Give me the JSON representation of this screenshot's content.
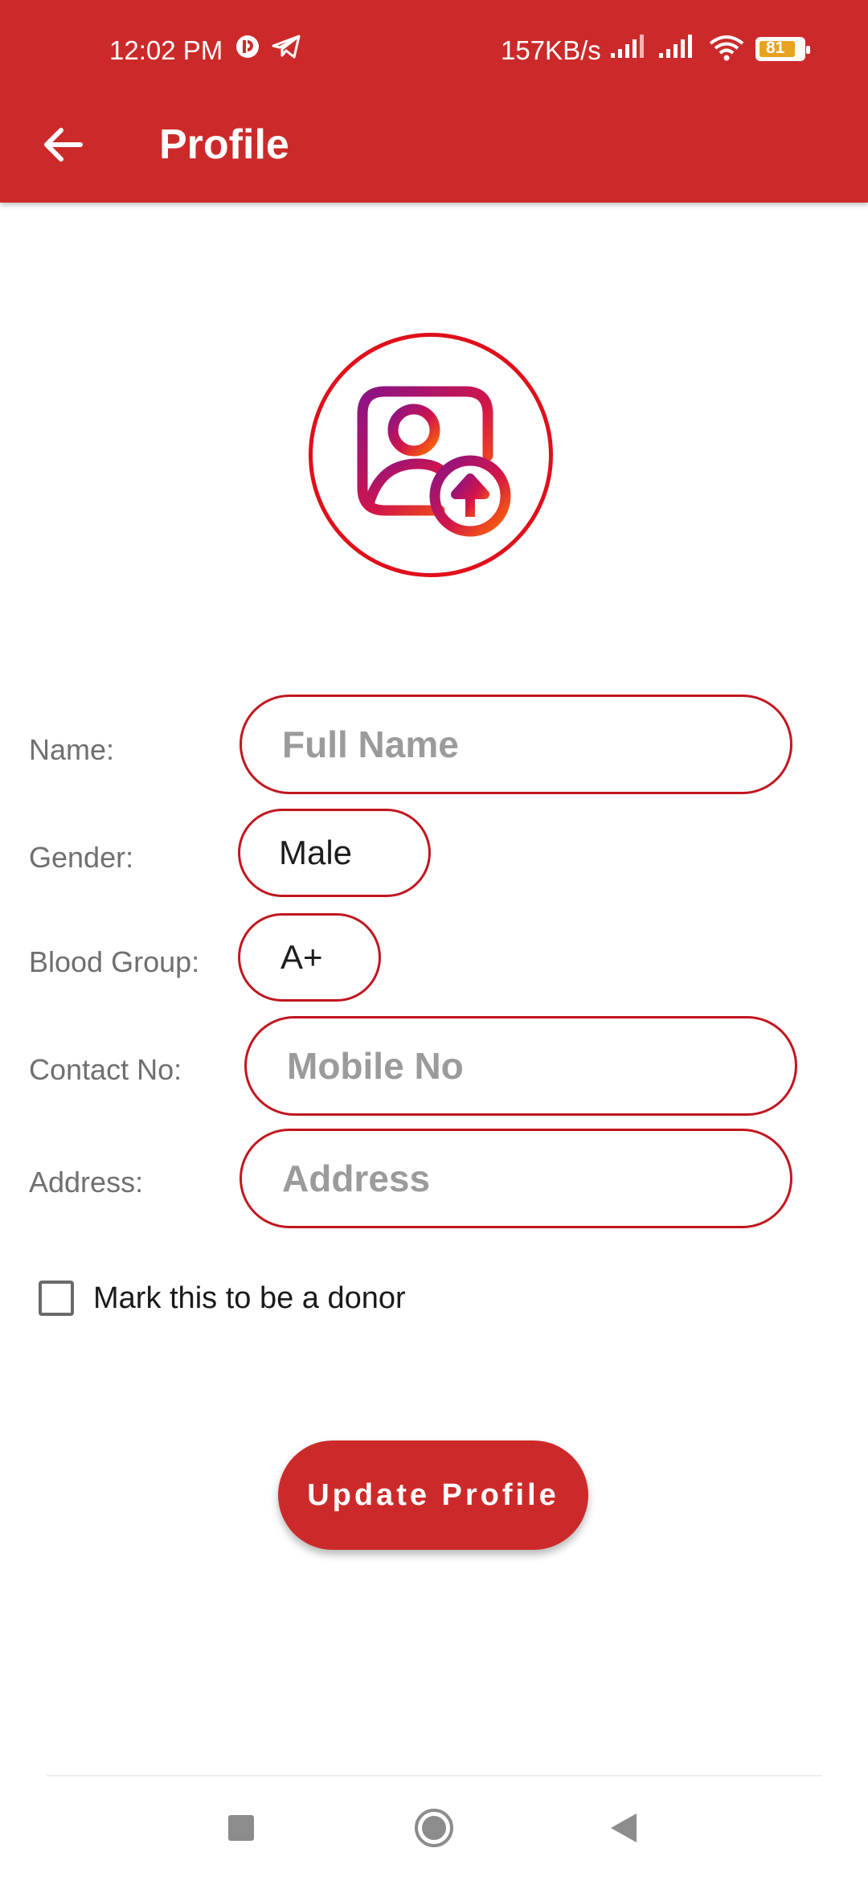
{
  "status_bar": {
    "time": "12:02 PM",
    "speed": "157KB/s",
    "battery": "81"
  },
  "header": {
    "title": "Profile"
  },
  "form": {
    "name_label": "Name:",
    "name_placeholder": "Full Name",
    "gender_label": "Gender:",
    "gender_value": "Male",
    "blood_label": "Blood Group:",
    "blood_value": "A+",
    "contact_label": "Contact No:",
    "contact_placeholder": "Mobile No",
    "address_label": "Address:",
    "address_placeholder": "Address",
    "donor_label": "Mark this to be a donor",
    "donor_checked": false
  },
  "actions": {
    "update_label": "Update Profile"
  },
  "colors": {
    "primary": "#cc2a2a",
    "field_border": "#c1161f",
    "avatar_ring": "#e00f1a"
  },
  "icons": [
    "back-arrow-icon",
    "upload-avatar-icon",
    "checkbox",
    "nav-recents-icon",
    "nav-home-icon",
    "nav-back-icon"
  ]
}
